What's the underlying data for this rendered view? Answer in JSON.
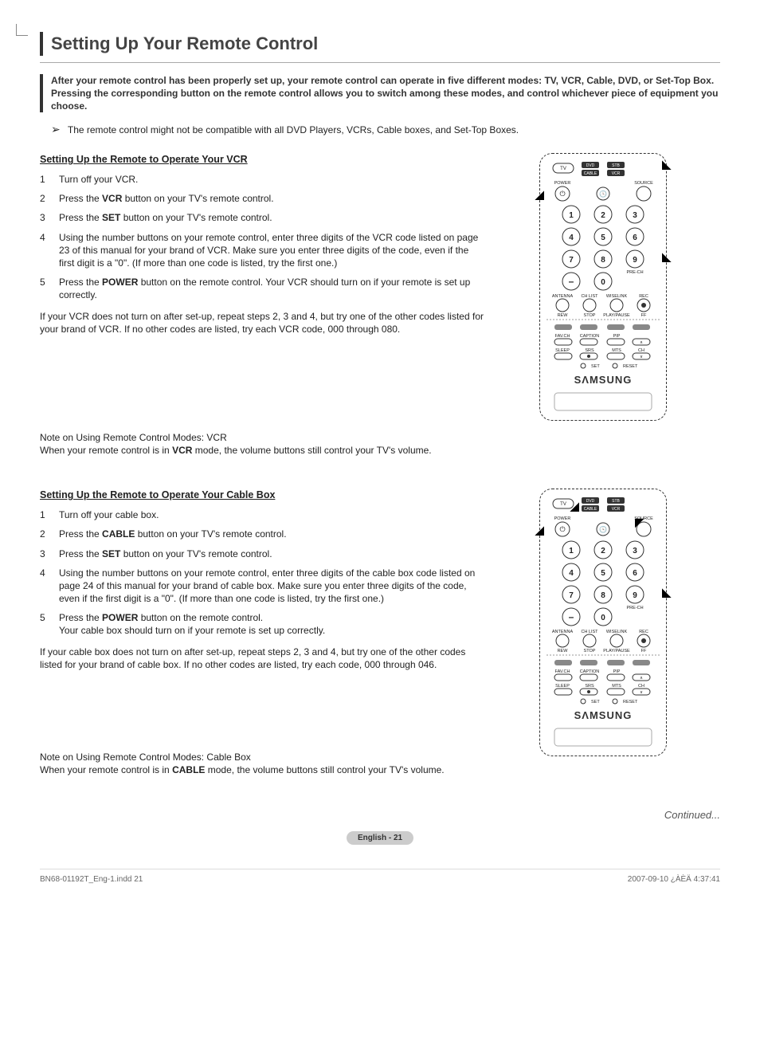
{
  "title": "Setting Up Your Remote Control",
  "intro": "After your remote control has been properly set up, your remote control can operate in five different modes: TV, VCR, Cable, DVD, or Set-Top Box. Pressing the corresponding button on the remote control allows you to switch among these modes, and control whichever piece of equipment you choose.",
  "compat_note": "The remote control might not be compatible with all DVD Players, VCRs, Cable boxes, and Set-Top Boxes.",
  "section_vcr": {
    "heading": "Setting Up the Remote to Operate Your VCR",
    "steps": {
      "s1": "Turn off your VCR.",
      "s2a": "Press the ",
      "s2b": "VCR",
      "s2c": " button on your TV's remote control.",
      "s3a": "Press the ",
      "s3b": "SET",
      "s3c": " button on your TV's remote control.",
      "s4": "Using the number buttons on your remote control, enter three digits of the VCR code listed on page 23 of this manual for your brand of VCR. Make sure you enter three digits of the code, even if the first digit is a \"0\". (If more than one code is listed, try the first one.)",
      "s5a": "Press the ",
      "s5b": "POWER",
      "s5c": " button on the remote control. Your VCR should turn on if your remote is set up correctly."
    },
    "fallback": "If your VCR does not turn on after set-up, repeat steps 2, 3 and 4, but try one of the other codes listed for your brand of VCR. If no other codes are listed, try each VCR code, 000 through 080.",
    "note_title": "Note on Using Remote Control Modes: VCR",
    "note_a": "When your remote control is in ",
    "note_b": "VCR",
    "note_c": " mode, the volume buttons still control your TV's volume."
  },
  "section_cable": {
    "heading": "Setting Up the Remote to Operate Your Cable Box",
    "steps": {
      "s1": "Turn off your cable box.",
      "s2a": "Press the ",
      "s2b": "CABLE",
      "s2c": " button on your TV's remote control.",
      "s3a": "Press the ",
      "s3b": "SET",
      "s3c": " button on your TV's remote control.",
      "s4": "Using the number buttons on your remote control, enter three digits of the cable box code listed on page 24 of this manual for your brand of cable box. Make sure you enter three digits of the code, even if the first digit is a \"0\". (If more than one code is listed, try the first one.)",
      "s5a": "Press the ",
      "s5b": "POWER",
      "s5c": " button on the remote control.",
      "s5d": "Your cable box should turn on if your remote is set up correctly."
    },
    "fallback": "If your cable box does not turn on after set-up, repeat steps 2, 3 and 4, but try one of the other codes listed for your brand of cable box. If no other codes are listed, try each code, 000 through 046.",
    "note_title": "Note on Using Remote Control Modes: Cable Box",
    "note_a": "When your remote control is in ",
    "note_b": "CABLE",
    "note_c": " mode, the volume buttons still control your TV's volume."
  },
  "remote": {
    "mode_tv": "TV",
    "mode_dvd": "DVD",
    "mode_stb": "STB",
    "mode_cable": "CABLE",
    "mode_vcr": "VCR",
    "lbl_power": "POWER",
    "lbl_source": "SOURCE",
    "lbl_prech": "PRE-CH",
    "lbl_antenna": "ANTENNA",
    "lbl_chlist": "CH LIST",
    "lbl_wiselink": "WISELINK",
    "lbl_rec": "REC",
    "lbl_rew": "REW",
    "lbl_stop": "STOP",
    "lbl_pp": "PLAY/PAUSE",
    "lbl_ff": "FF",
    "lbl_favch": "FAV.CH",
    "lbl_caption": "CAPTION",
    "lbl_pip": "PIP",
    "lbl_sleep": "SLEEP",
    "lbl_srs": "SRS",
    "lbl_mts": "MTS",
    "lbl_ch": "CH",
    "lbl_set": "SET",
    "lbl_reset": "RESET",
    "brand": "SΛMSUNG",
    "n1": "1",
    "n2": "2",
    "n3": "3",
    "n4": "4",
    "n5": "5",
    "n6": "6",
    "n7": "7",
    "n8": "8",
    "n9": "9",
    "n0": "0",
    "dash": "–"
  },
  "continued": "Continued...",
  "page_badge": "English - 21",
  "footer_left": "BN68-01192T_Eng-1.indd   21",
  "footer_right": "2007-09-10   ¿ÀÈÄ 4:37:41"
}
